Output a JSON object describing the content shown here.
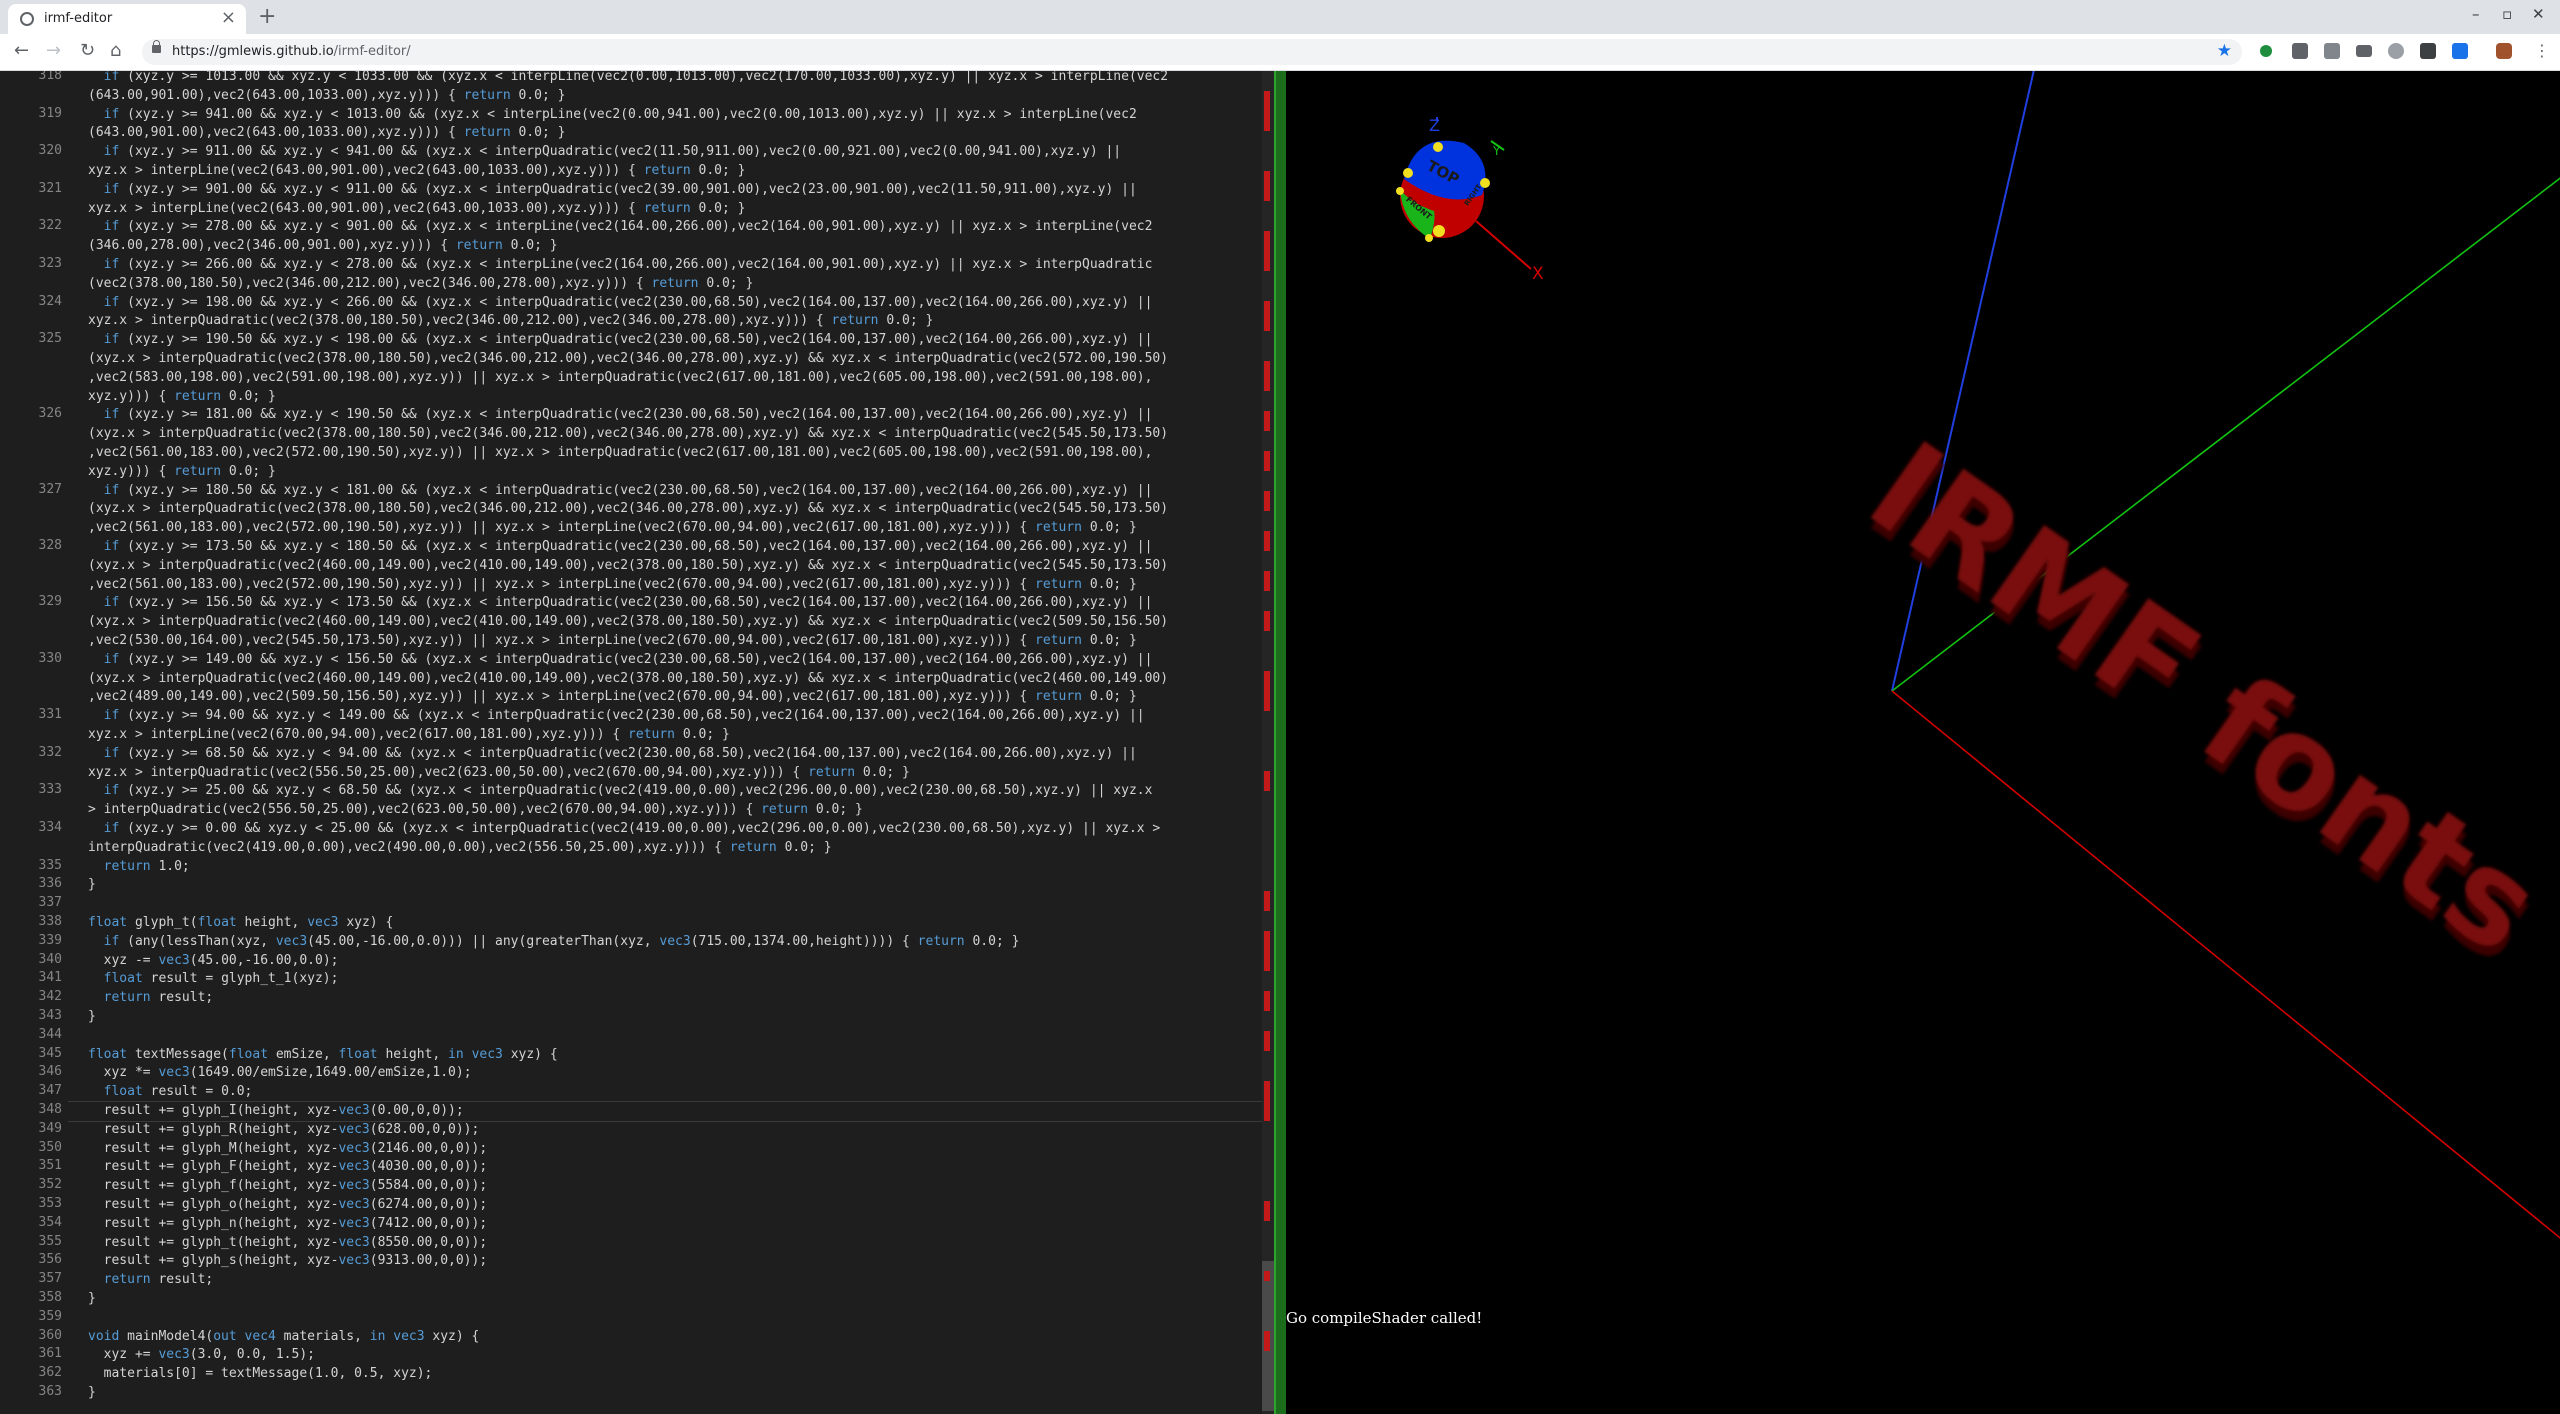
{
  "browser": {
    "tab_title": "irmf-editor",
    "tab_close": "×",
    "new_tab": "+",
    "url_host": "https://gmlewis.github.io",
    "url_path": "/irmf-editor/",
    "window_controls": [
      "–",
      "▫",
      "✕"
    ],
    "star": "★",
    "nav": {
      "back": "←",
      "forward": "→",
      "reload": "↻",
      "home": "⌂"
    }
  },
  "editor": {
    "lines": [
      {
        "n": "318",
        "t": "  if (xyz.y >= 1013.00 && xyz.y < 1033.00 && (xyz.x < interpLine(vec2(0.00,1013.00),vec2(170.00,1033.00),xyz.y) || xyz.x > interpLine(vec2"
      },
      {
        "n": "",
        "t": "(643.00,901.00),vec2(643.00,1033.00),xyz.y))) { return 0.0; }"
      },
      {
        "n": "319",
        "t": "  if (xyz.y >= 941.00 && xyz.y < 1013.00 && (xyz.x < interpLine(vec2(0.00,941.00),vec2(0.00,1013.00),xyz.y) || xyz.x > interpLine(vec2"
      },
      {
        "n": "",
        "t": "(643.00,901.00),vec2(643.00,1033.00),xyz.y))) { return 0.0; }"
      },
      {
        "n": "320",
        "t": "  if (xyz.y >= 911.00 && xyz.y < 941.00 && (xyz.x < interpQuadratic(vec2(11.50,911.00),vec2(0.00,921.00),vec2(0.00,941.00),xyz.y) ||"
      },
      {
        "n": "",
        "t": "xyz.x > interpLine(vec2(643.00,901.00),vec2(643.00,1033.00),xyz.y))) { return 0.0; }"
      },
      {
        "n": "321",
        "t": "  if (xyz.y >= 901.00 && xyz.y < 911.00 && (xyz.x < interpQuadratic(vec2(39.00,901.00),vec2(23.00,901.00),vec2(11.50,911.00),xyz.y) ||"
      },
      {
        "n": "",
        "t": "xyz.x > interpLine(vec2(643.00,901.00),vec2(643.00,1033.00),xyz.y))) { return 0.0; }"
      },
      {
        "n": "322",
        "t": "  if (xyz.y >= 278.00 && xyz.y < 901.00 && (xyz.x < interpLine(vec2(164.00,266.00),vec2(164.00,901.00),xyz.y) || xyz.x > interpLine(vec2"
      },
      {
        "n": "",
        "t": "(346.00,278.00),vec2(346.00,901.00),xyz.y))) { return 0.0; }"
      },
      {
        "n": "323",
        "t": "  if (xyz.y >= 266.00 && xyz.y < 278.00 && (xyz.x < interpLine(vec2(164.00,266.00),vec2(164.00,901.00),xyz.y) || xyz.x > interpQuadratic"
      },
      {
        "n": "",
        "t": "(vec2(378.00,180.50),vec2(346.00,212.00),vec2(346.00,278.00),xyz.y))) { return 0.0; }"
      },
      {
        "n": "324",
        "t": "  if (xyz.y >= 198.00 && xyz.y < 266.00 && (xyz.x < interpQuadratic(vec2(230.00,68.50),vec2(164.00,137.00),vec2(164.00,266.00),xyz.y) ||"
      },
      {
        "n": "",
        "t": "xyz.x > interpQuadratic(vec2(378.00,180.50),vec2(346.00,212.00),vec2(346.00,278.00),xyz.y))) { return 0.0; }"
      },
      {
        "n": "325",
        "t": "  if (xyz.y >= 190.50 && xyz.y < 198.00 && (xyz.x < interpQuadratic(vec2(230.00,68.50),vec2(164.00,137.00),vec2(164.00,266.00),xyz.y) ||"
      },
      {
        "n": "",
        "t": "(xyz.x > interpQuadratic(vec2(378.00,180.50),vec2(346.00,212.00),vec2(346.00,278.00),xyz.y) && xyz.x < interpQuadratic(vec2(572.00,190.50)"
      },
      {
        "n": "",
        "t": ",vec2(583.00,198.00),vec2(591.00,198.00),xyz.y)) || xyz.x > interpQuadratic(vec2(617.00,181.00),vec2(605.00,198.00),vec2(591.00,198.00),"
      },
      {
        "n": "",
        "t": "xyz.y))) { return 0.0; }"
      },
      {
        "n": "326",
        "t": "  if (xyz.y >= 181.00 && xyz.y < 190.50 && (xyz.x < interpQuadratic(vec2(230.00,68.50),vec2(164.00,137.00),vec2(164.00,266.00),xyz.y) ||"
      },
      {
        "n": "",
        "t": "(xyz.x > interpQuadratic(vec2(378.00,180.50),vec2(346.00,212.00),vec2(346.00,278.00),xyz.y) && xyz.x < interpQuadratic(vec2(545.50,173.50)"
      },
      {
        "n": "",
        "t": ",vec2(561.00,183.00),vec2(572.00,190.50),xyz.y)) || xyz.x > interpQuadratic(vec2(617.00,181.00),vec2(605.00,198.00),vec2(591.00,198.00),"
      },
      {
        "n": "",
        "t": "xyz.y))) { return 0.0; }"
      },
      {
        "n": "327",
        "t": "  if (xyz.y >= 180.50 && xyz.y < 181.00 && (xyz.x < interpQuadratic(vec2(230.00,68.50),vec2(164.00,137.00),vec2(164.00,266.00),xyz.y) ||"
      },
      {
        "n": "",
        "t": "(xyz.x > interpQuadratic(vec2(378.00,180.50),vec2(346.00,212.00),vec2(346.00,278.00),xyz.y) && xyz.x < interpQuadratic(vec2(545.50,173.50)"
      },
      {
        "n": "",
        "t": ",vec2(561.00,183.00),vec2(572.00,190.50),xyz.y)) || xyz.x > interpLine(vec2(670.00,94.00),vec2(617.00,181.00),xyz.y))) { return 0.0; }"
      },
      {
        "n": "328",
        "t": "  if (xyz.y >= 173.50 && xyz.y < 180.50 && (xyz.x < interpQuadratic(vec2(230.00,68.50),vec2(164.00,137.00),vec2(164.00,266.00),xyz.y) ||"
      },
      {
        "n": "",
        "t": "(xyz.x > interpQuadratic(vec2(460.00,149.00),vec2(410.00,149.00),vec2(378.00,180.50),xyz.y) && xyz.x < interpQuadratic(vec2(545.50,173.50)"
      },
      {
        "n": "",
        "t": ",vec2(561.00,183.00),vec2(572.00,190.50),xyz.y)) || xyz.x > interpLine(vec2(670.00,94.00),vec2(617.00,181.00),xyz.y))) { return 0.0; }"
      },
      {
        "n": "329",
        "t": "  if (xyz.y >= 156.50 && xyz.y < 173.50 && (xyz.x < interpQuadratic(vec2(230.00,68.50),vec2(164.00,137.00),vec2(164.00,266.00),xyz.y) ||"
      },
      {
        "n": "",
        "t": "(xyz.x > interpQuadratic(vec2(460.00,149.00),vec2(410.00,149.00),vec2(378.00,180.50),xyz.y) && xyz.x < interpQuadratic(vec2(509.50,156.50)"
      },
      {
        "n": "",
        "t": ",vec2(530.00,164.00),vec2(545.50,173.50),xyz.y)) || xyz.x > interpLine(vec2(670.00,94.00),vec2(617.00,181.00),xyz.y))) { return 0.0; }"
      },
      {
        "n": "330",
        "t": "  if (xyz.y >= 149.00 && xyz.y < 156.50 && (xyz.x < interpQuadratic(vec2(230.00,68.50),vec2(164.00,137.00),vec2(164.00,266.00),xyz.y) ||"
      },
      {
        "n": "",
        "t": "(xyz.x > interpQuadratic(vec2(460.00,149.00),vec2(410.00,149.00),vec2(378.00,180.50),xyz.y) && xyz.x < interpQuadratic(vec2(460.00,149.00)"
      },
      {
        "n": "",
        "t": ",vec2(489.00,149.00),vec2(509.50,156.50),xyz.y)) || xyz.x > interpLine(vec2(670.00,94.00),vec2(617.00,181.00),xyz.y))) { return 0.0; }"
      },
      {
        "n": "331",
        "t": "  if (xyz.y >= 94.00 && xyz.y < 149.00 && (xyz.x < interpQuadratic(vec2(230.00,68.50),vec2(164.00,137.00),vec2(164.00,266.00),xyz.y) ||"
      },
      {
        "n": "",
        "t": "xyz.x > interpLine(vec2(670.00,94.00),vec2(617.00,181.00),xyz.y))) { return 0.0; }"
      },
      {
        "n": "332",
        "t": "  if (xyz.y >= 68.50 && xyz.y < 94.00 && (xyz.x < interpQuadratic(vec2(230.00,68.50),vec2(164.00,137.00),vec2(164.00,266.00),xyz.y) ||"
      },
      {
        "n": "",
        "t": "xyz.x > interpQuadratic(vec2(556.50,25.00),vec2(623.00,50.00),vec2(670.00,94.00),xyz.y))) { return 0.0; }"
      },
      {
        "n": "333",
        "t": "  if (xyz.y >= 25.00 && xyz.y < 68.50 && (xyz.x < interpQuadratic(vec2(419.00,0.00),vec2(296.00,0.00),vec2(230.00,68.50),xyz.y) || xyz.x"
      },
      {
        "n": "",
        "t": "> interpQuadratic(vec2(556.50,25.00),vec2(623.00,50.00),vec2(670.00,94.00),xyz.y))) { return 0.0; }"
      },
      {
        "n": "334",
        "t": "  if (xyz.y >= 0.00 && xyz.y < 25.00 && (xyz.x < interpQuadratic(vec2(419.00,0.00),vec2(296.00,0.00),vec2(230.00,68.50),xyz.y) || xyz.x >"
      },
      {
        "n": "",
        "t": "interpQuadratic(vec2(419.00,0.00),vec2(490.00,0.00),vec2(556.50,25.00),xyz.y))) { return 0.0; }"
      },
      {
        "n": "335",
        "t": "  return 1.0;"
      },
      {
        "n": "336",
        "t": "}"
      },
      {
        "n": "337",
        "t": ""
      },
      {
        "n": "338",
        "t": "float glyph_t(float height, vec3 xyz) {"
      },
      {
        "n": "339",
        "t": "  if (any(lessThan(xyz, vec3(45.00,-16.00,0.0))) || any(greaterThan(xyz, vec3(715.00,1374.00,height)))) { return 0.0; }"
      },
      {
        "n": "340",
        "t": "  xyz -= vec3(45.00,-16.00,0.0);"
      },
      {
        "n": "341",
        "t": "  float result = glyph_t_1(xyz);"
      },
      {
        "n": "342",
        "t": "  return result;"
      },
      {
        "n": "343",
        "t": "}"
      },
      {
        "n": "344",
        "t": ""
      },
      {
        "n": "345",
        "t": "float textMessage(float emSize, float height, in vec3 xyz) {"
      },
      {
        "n": "346",
        "t": "  xyz *= vec3(1649.00/emSize,1649.00/emSize,1.0);"
      },
      {
        "n": "347",
        "t": "  float result = 0.0;"
      },
      {
        "n": "348",
        "t": "  result += glyph_I(height, xyz-vec3(0.00,0,0));"
      },
      {
        "n": "349",
        "t": "  result += glyph_R(height, xyz-vec3(628.00,0,0));"
      },
      {
        "n": "350",
        "t": "  result += glyph_M(height, xyz-vec3(2146.00,0,0));"
      },
      {
        "n": "351",
        "t": "  result += glyph_F(height, xyz-vec3(4030.00,0,0));"
      },
      {
        "n": "352",
        "t": "  result += glyph_f(height, xyz-vec3(5584.00,0,0));"
      },
      {
        "n": "353",
        "t": "  result += glyph_o(height, xyz-vec3(6274.00,0,0));"
      },
      {
        "n": "354",
        "t": "  result += glyph_n(height, xyz-vec3(7412.00,0,0));"
      },
      {
        "n": "355",
        "t": "  result += glyph_t(height, xyz-vec3(8550.00,0,0));"
      },
      {
        "n": "356",
        "t": "  result += glyph_s(height, xyz-vec3(9313.00,0,0));"
      },
      {
        "n": "357",
        "t": "  return result;"
      },
      {
        "n": "358",
        "t": "}"
      },
      {
        "n": "359",
        "t": ""
      },
      {
        "n": "360",
        "t": "void mainModel4(out vec4 materials, in vec3 xyz) {"
      },
      {
        "n": "361",
        "t": "  xyz += vec3(3.0, 0.0, 1.5);"
      },
      {
        "n": "362",
        "t": "  materials[0] = textMessage(1.0, 0.5, xyz);"
      },
      {
        "n": "363",
        "t": "}"
      }
    ],
    "current_line": "348"
  },
  "viewport": {
    "model_text": "IRMF fonts",
    "message": "Go compileShader called!",
    "axes": {
      "x": "X",
      "y": "Y",
      "z": "Z"
    },
    "cube_face_labels": [
      "TOP",
      "FRONT",
      "RIGHT"
    ]
  },
  "colors": {
    "editor_bg": "#1e1e1e",
    "keyword": "#569cd6",
    "divider": "#1b6d1b",
    "model_red": "#7a0b0b",
    "axis_x": "#d40000",
    "axis_y": "#12c212",
    "axis_z": "#1f3fe0"
  }
}
